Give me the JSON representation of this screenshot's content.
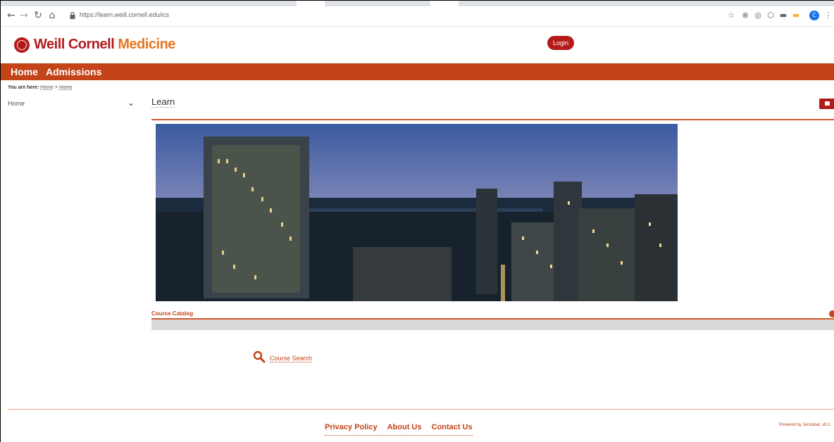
{
  "browser": {
    "url": "https://learn.weill.cornell.edu/ics",
    "nav_icons": [
      "back-arrow-icon",
      "forward-arrow-icon",
      "reload-icon",
      "home-icon"
    ],
    "extension_avatar": "C"
  },
  "site": {
    "logo_part1": "Weill Cornell ",
    "logo_part2": "Medicine",
    "login_label": "Login",
    "brand_color": "#b31b1b",
    "accent_color": "#c4441a"
  },
  "nav": {
    "items": [
      {
        "label": "Home"
      },
      {
        "label": "Admissions"
      }
    ]
  },
  "breadcrumb": {
    "prefix": "You are here:",
    "items": [
      "Home",
      "Home"
    ],
    "separator": ">"
  },
  "sidebar": {
    "current": "Home"
  },
  "content": {
    "title": "Learn",
    "catalog_title": "Course Catalog",
    "course_search_label": "Course Search"
  },
  "footer": {
    "links": [
      "Privacy Policy",
      "About Us",
      "Contact Us"
    ],
    "powered": "Powered by Jenzabar. v9.2."
  }
}
